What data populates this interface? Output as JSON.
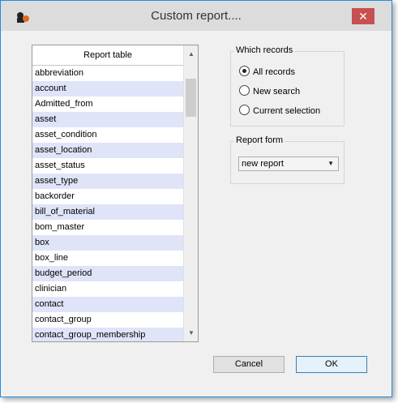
{
  "window": {
    "title": "Custom report....",
    "close_glyph": "✕"
  },
  "report_table": {
    "header": "Report table",
    "rows": [
      "abbreviation",
      "account",
      "Admitted_from",
      "asset",
      "asset_condition",
      "asset_location",
      "asset_status",
      "asset_type",
      "backorder",
      "bill_of_material",
      "bom_master",
      "box",
      "box_line",
      "budget_period",
      "clinician",
      "contact",
      "contact_group",
      "contact_group_membership"
    ]
  },
  "which_records": {
    "label": "Which records",
    "options": [
      "All records",
      "New search",
      "Current selection"
    ],
    "selected": "All records"
  },
  "report_form": {
    "label": "Report form",
    "value": "new report"
  },
  "buttons": {
    "cancel": "Cancel",
    "ok": "OK"
  },
  "colors": {
    "row_alt": "#dfe4f8",
    "close_button": "#c75050",
    "window_border": "#1f8fd9"
  }
}
